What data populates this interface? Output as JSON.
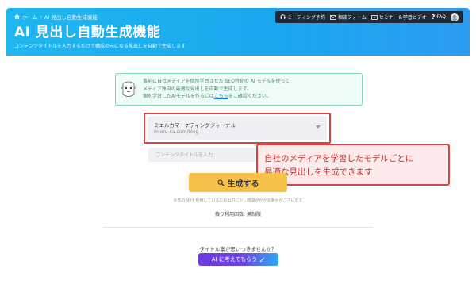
{
  "header": {
    "breadcrumb": {
      "home": "ホーム",
      "separator": "›",
      "current": "AI 見出し自動生成機能"
    },
    "title": "AI 見出し自動生成機能",
    "subtitle": "コンテンツタイトルを入力するだけで構成の元になる見出しを自動で生成します",
    "nav": [
      {
        "label": "ミーティング予約",
        "icon": "headset-icon"
      },
      {
        "label": "相談フォーム",
        "icon": "mail-icon"
      },
      {
        "label": "セミナー＆学習ビデオ",
        "icon": "video-icon"
      },
      {
        "label": "FAQ",
        "icon": "question-icon"
      }
    ]
  },
  "info": {
    "line1": "事前に自社メディアを個別学習させた SEO特化の AI モデルを使って",
    "line2": "メディア独自の最適な見出しを自動で生成します。",
    "line3_prefix": "個別学習したAIモデルを作るには",
    "line3_link": "こちら",
    "line3_suffix": "をご確認ください。"
  },
  "media_select": {
    "name": "ミエルカマーケティングジャーナル",
    "url": "mieru-ca.com/blog"
  },
  "title_input": {
    "value": "",
    "placeholder": "コンテンツタイトルを入力"
  },
  "callout": {
    "line1": "自社のメディアを学習したモデルごとに",
    "line2": "最適な見出しを生成できます"
  },
  "generate_button": {
    "label": "生成する"
  },
  "notice": "外部のAPIを利用しているため出力に少し時間がかかる場合がございます",
  "usage": "残り利用回数: 無制限",
  "ask": "タイトル案が思いつきませんか？",
  "ai_button": {
    "label": "AI に考えてもらう"
  },
  "colors": {
    "header_gradient_start": "#1fb6f0",
    "header_gradient_end": "#2d9cf0",
    "accent_yellow": "#f8c24a",
    "callout_red": "#e34242",
    "info_green_border": "#7dd6b4",
    "ai_gradient_start": "#6a3ce0",
    "ai_gradient_end": "#2ea9f0"
  }
}
